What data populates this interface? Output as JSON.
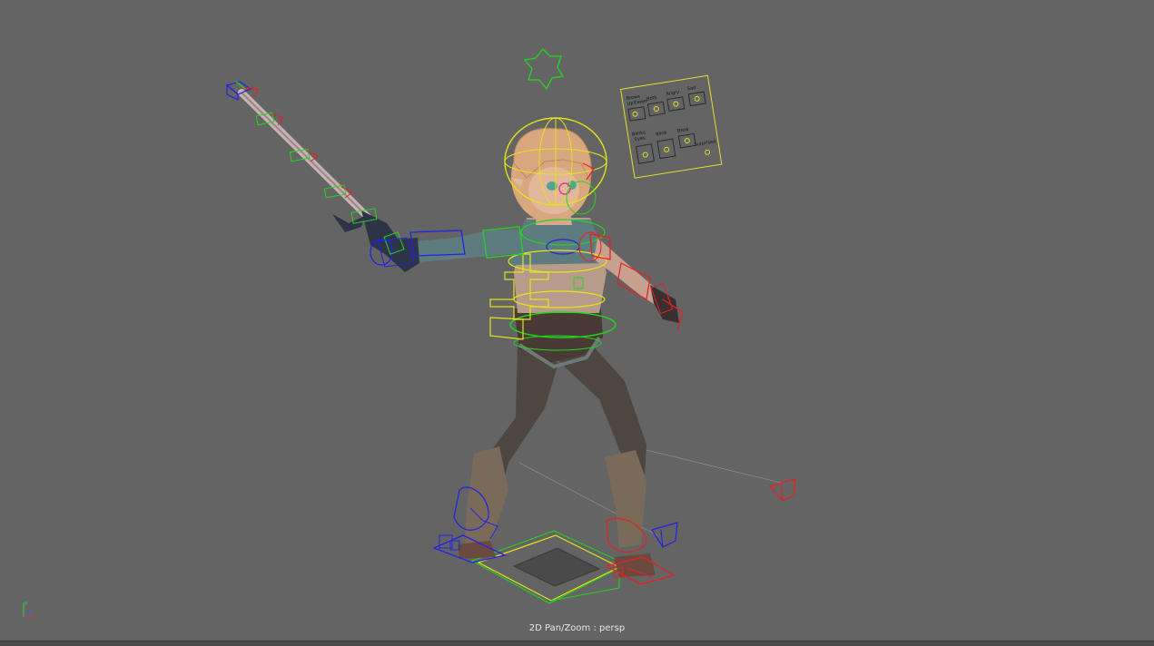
{
  "viewport": {
    "camera_label": "2D Pan/Zoom : persp",
    "background_color": "#646464"
  },
  "picker": {
    "labels": [
      "Brows",
      "Up/Down",
      "Both",
      "Angry",
      "Sad",
      "Blinks",
      "Eyes",
      "Blink",
      "Brow",
      "Surprised"
    ]
  },
  "colors": {
    "control_yellow": "#e5e21c",
    "control_green": "#1ed81e",
    "control_red": "#e82020",
    "control_blue": "#2222e6",
    "control_pink": "#e436a8"
  },
  "icons": {
    "axis": "xyz-axis-gizmo"
  }
}
